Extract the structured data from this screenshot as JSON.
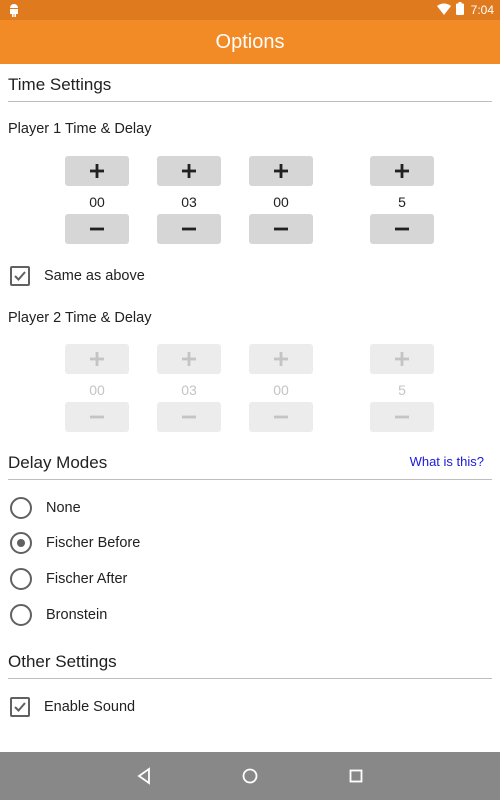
{
  "status_bar": {
    "time": "7:04",
    "icons": [
      "android-debug-icon",
      "wifi-icon",
      "battery-icon"
    ]
  },
  "app_bar": {
    "title": "Options"
  },
  "time_settings": {
    "header": "Time Settings",
    "player1": {
      "label": "Player 1 Time & Delay",
      "values": [
        "00",
        "03",
        "00",
        "5"
      ]
    },
    "same_as_above": {
      "label": "Same as above",
      "checked": true
    },
    "player2": {
      "label": "Player 2 Time & Delay",
      "values": [
        "00",
        "03",
        "00",
        "5"
      ],
      "disabled": true
    }
  },
  "delay_modes": {
    "header": "Delay Modes",
    "help_link": "What is this?",
    "options": [
      "None",
      "Fischer Before",
      "Fischer After",
      "Bronstein"
    ],
    "selected": "Fischer Before"
  },
  "other_settings": {
    "header": "Other Settings",
    "enable_sound": {
      "label": "Enable Sound",
      "checked": true
    }
  },
  "nav_bar": {
    "buttons": [
      "back-icon",
      "home-icon",
      "recents-icon"
    ]
  },
  "colors": {
    "accent": "#f28a25",
    "status_bar": "#e07a1f",
    "link": "#1a1adb",
    "nav_bar": "#888888"
  }
}
